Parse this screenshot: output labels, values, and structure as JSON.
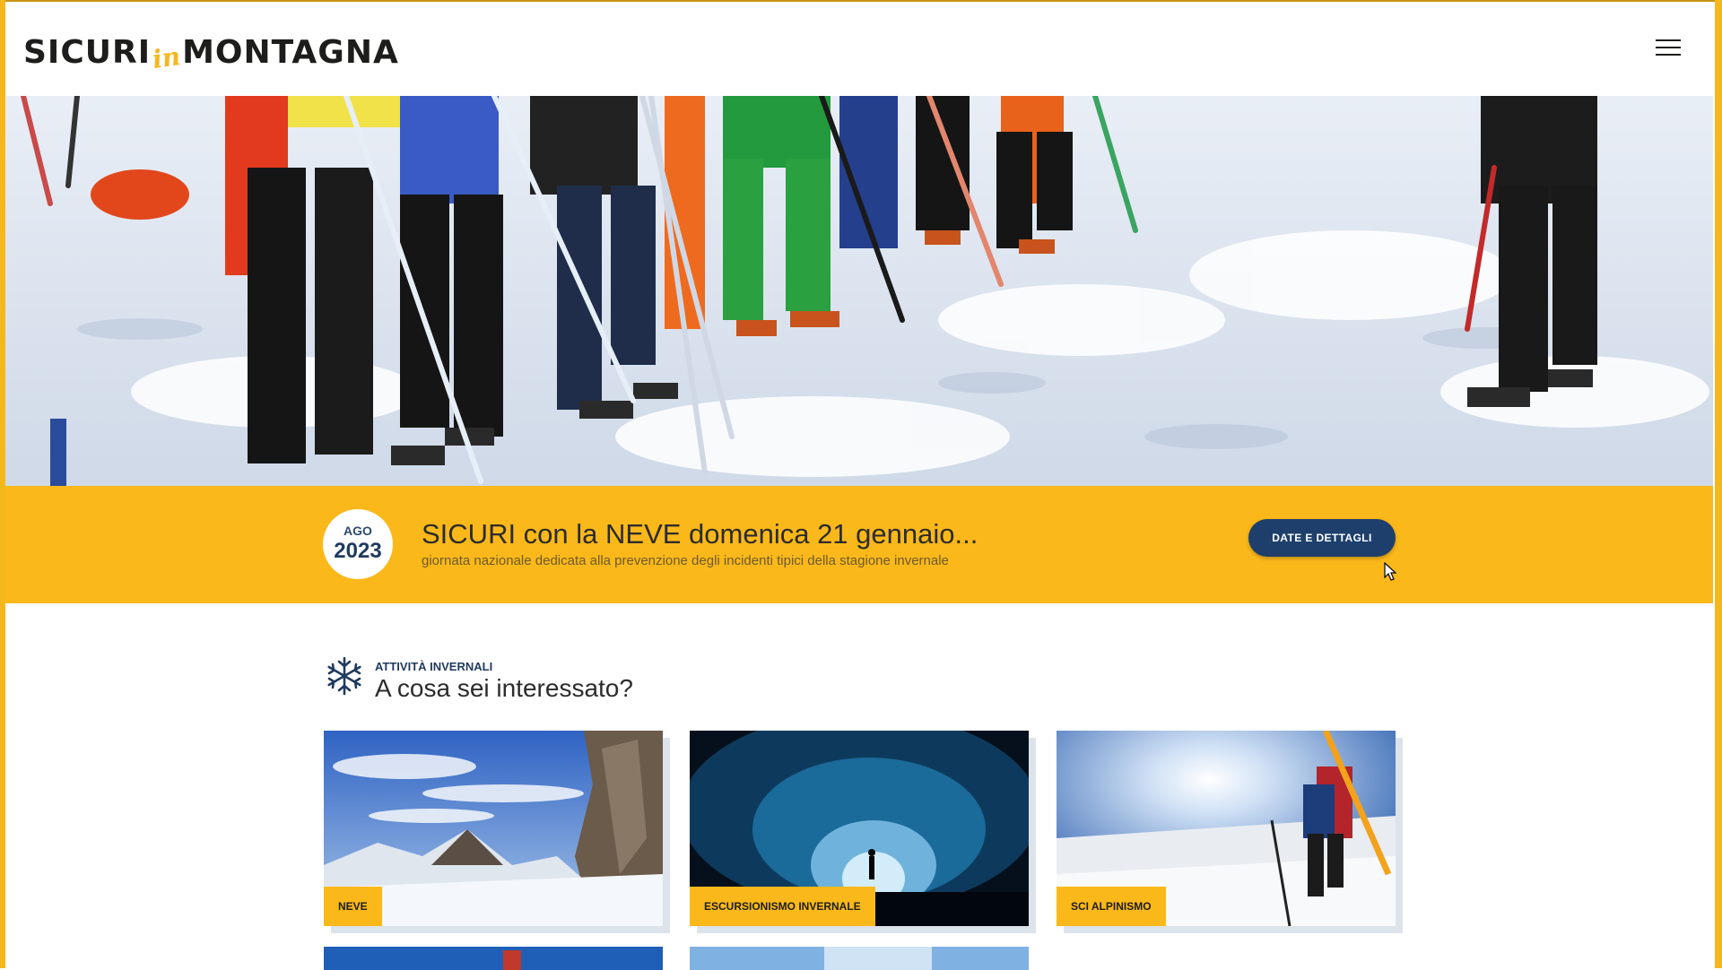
{
  "header": {
    "logo_part1": "SICURI",
    "logo_part2": "in",
    "logo_part3": "MONTAGNA",
    "menu_icon": "hamburger-menu-icon"
  },
  "event": {
    "month": "AGO",
    "year": "2023",
    "title": "SICURI con la NEVE domenica 21 gennaio...",
    "subtitle": "giornata nazionale dedicata alla prevenzione degli incidenti tipici della stagione invernale",
    "button_label": "DATE E DETTAGLI"
  },
  "interests": {
    "kicker": "ATTIVITÀ INVERNALI",
    "title": "A cosa sei interessato?",
    "icon": "snowflake-icon",
    "cards": [
      {
        "label": "NEVE"
      },
      {
        "label": "ESCURSIONISMO INVERNALE"
      },
      {
        "label": "SCI ALPINISMO"
      }
    ]
  },
  "colors": {
    "accent_yellow": "#fbb81a",
    "navy": "#1e3f6b",
    "text_dark": "#2c2c2c"
  }
}
